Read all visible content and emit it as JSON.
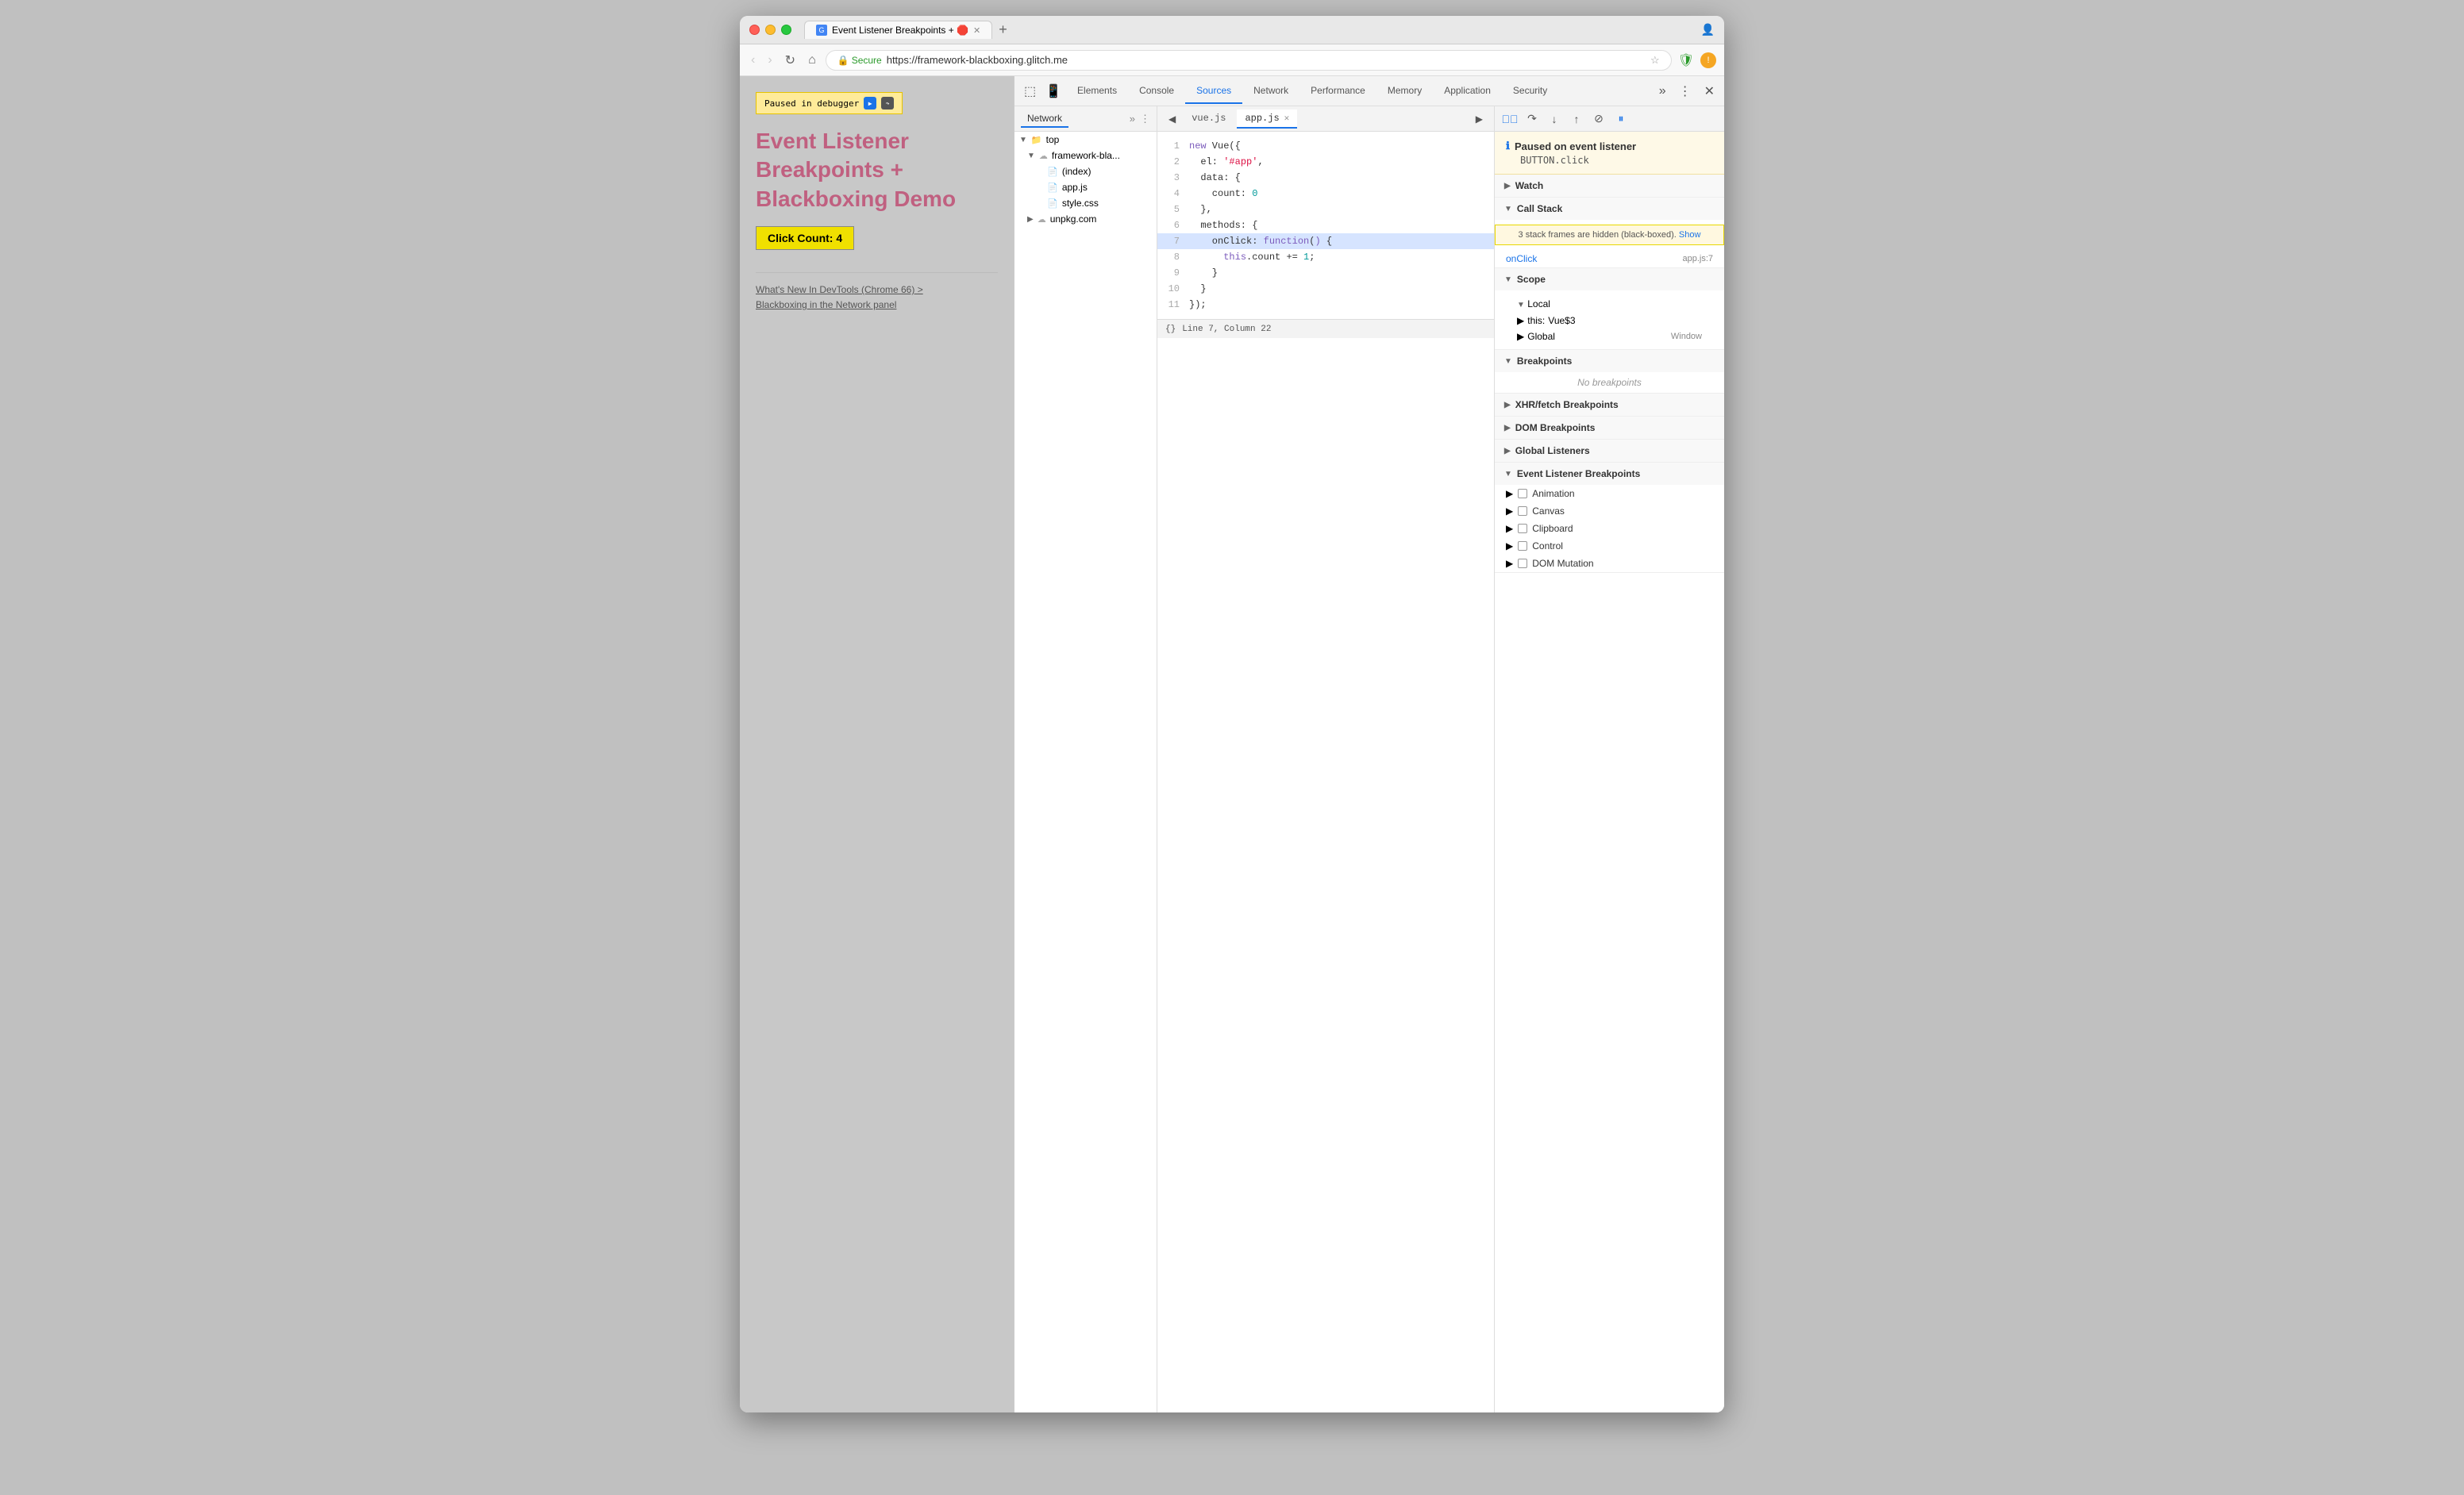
{
  "browser": {
    "tab_title": "Event Listener Breakpoints + 🛑",
    "tab_favicon": "🌐",
    "url_secure": "Secure",
    "url": "https://framework-blackboxing.glitch.me",
    "new_tab_label": "+"
  },
  "webpage": {
    "paused_banner": "Paused in debugger",
    "title_line1": "Event Listener",
    "title_line2": "Breakpoints +",
    "title_line3": "Blackboxing Demo",
    "click_count": "Click Count: 4",
    "link1": "What's New In DevTools (Chrome 66) >",
    "link2": "Blackboxing in the Network panel"
  },
  "devtools": {
    "tabs": [
      "Elements",
      "Console",
      "Sources",
      "Network",
      "Performance",
      "Memory",
      "Application",
      "Security"
    ],
    "active_tab": "Sources",
    "file_tree": {
      "network_tab": "Network",
      "items": [
        {
          "level": 0,
          "label": "top",
          "type": "folder",
          "arrow": "▼"
        },
        {
          "level": 1,
          "label": "framework-bla...",
          "type": "cloud-folder",
          "arrow": "▼"
        },
        {
          "level": 2,
          "label": "(index)",
          "type": "html",
          "arrow": ""
        },
        {
          "level": 2,
          "label": "app.js",
          "type": "js",
          "arrow": ""
        },
        {
          "level": 2,
          "label": "style.css",
          "type": "css",
          "arrow": ""
        },
        {
          "level": 1,
          "label": "unpkg.com",
          "type": "cloud-folder",
          "arrow": "▶"
        }
      ]
    },
    "editor": {
      "tabs": [
        "vue.js",
        "app.js"
      ],
      "active_tab": "app.js",
      "lines": [
        {
          "num": "1",
          "code": "new Vue({",
          "highlight": false
        },
        {
          "num": "2",
          "code": "  el: '#app',",
          "highlight": false
        },
        {
          "num": "3",
          "code": "  data: {",
          "highlight": false
        },
        {
          "num": "4",
          "code": "    count: 0",
          "highlight": false
        },
        {
          "num": "5",
          "code": "  },",
          "highlight": false
        },
        {
          "num": "6",
          "code": "  methods: {",
          "highlight": false
        },
        {
          "num": "7",
          "code": "    onClick: function() {",
          "highlight": true
        },
        {
          "num": "8",
          "code": "      this.count += 1;",
          "highlight": false
        },
        {
          "num": "9",
          "code": "    }",
          "highlight": false
        },
        {
          "num": "10",
          "code": "  }",
          "highlight": false
        },
        {
          "num": "11",
          "code": "});",
          "highlight": false
        }
      ],
      "statusbar": "Line 7, Column 22",
      "statusbar_icon": "{}"
    },
    "right_panel": {
      "paused_title": "Paused on event listener",
      "paused_detail": "BUTTON.click",
      "sections": {
        "watch": "Watch",
        "call_stack": "Call Stack",
        "call_stack_warning": "3 stack frames are hidden (black-boxed).",
        "call_stack_show": "Show",
        "onClick_label": "onClick",
        "onClick_loc": "app.js:7",
        "scope": "Scope",
        "local": "Local",
        "this_val": "this",
        "this_type": "Vue$3",
        "global": "Global",
        "global_val": "Window",
        "breakpoints": "Breakpoints",
        "no_breakpoints": "No breakpoints",
        "xhr_breakpoints": "XHR/fetch Breakpoints",
        "dom_breakpoints": "DOM Breakpoints",
        "global_listeners": "Global Listeners",
        "event_listener_breakpoints": "Event Listener Breakpoints",
        "animation": "Animation",
        "canvas": "Canvas",
        "clipboard": "Clipboard",
        "control": "Control",
        "dom_mutation": "DOM Mutation"
      }
    }
  }
}
